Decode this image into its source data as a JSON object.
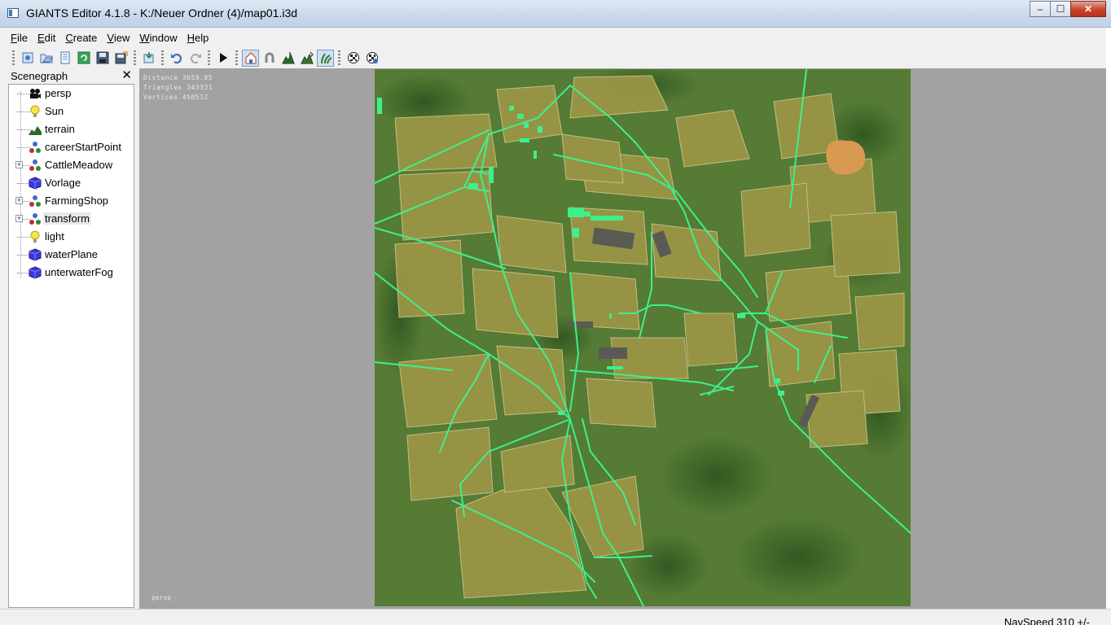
{
  "window": {
    "title": "GIANTS Editor 4.1.8 - K:/Neuer Ordner (4)/map01.i3d",
    "minimize": "–",
    "maximize": "☐",
    "close": "✕"
  },
  "menu": [
    {
      "label": "File",
      "mnemonic": "F",
      "rest": "ile"
    },
    {
      "label": "Edit",
      "mnemonic": "E",
      "rest": "dit"
    },
    {
      "label": "Create",
      "mnemonic": "C",
      "rest": "reate"
    },
    {
      "label": "View",
      "mnemonic": "V",
      "rest": "iew"
    },
    {
      "label": "Window",
      "mnemonic": "W",
      "rest": "indow"
    },
    {
      "label": "Help",
      "mnemonic": "H",
      "rest": "elp"
    }
  ],
  "toolbar": {
    "icons": [
      "new-icon",
      "open-icon",
      "list-icon",
      "reload-icon",
      "save-icon",
      "save-all-icon",
      "import-icon",
      "undo-icon",
      "redo-icon",
      "play-icon",
      "home-icon",
      "magnet-icon",
      "terrain-sculpt-icon",
      "terrain-paint-icon",
      "foliage-paint-icon",
      "checker-icon",
      "checker-settings-icon"
    ]
  },
  "scenegraph": {
    "title": "Scenegraph",
    "close": "✕",
    "items": [
      {
        "label": "persp",
        "icon": "camera-icon",
        "expandable": false
      },
      {
        "label": "Sun",
        "icon": "light-bulb-icon",
        "expandable": false
      },
      {
        "label": "terrain",
        "icon": "terrain-icon",
        "expandable": false
      },
      {
        "label": "careerStartPoint",
        "icon": "transform-group-icon",
        "expandable": false
      },
      {
        "label": "CattleMeadow",
        "icon": "transform-group-icon",
        "expandable": true
      },
      {
        "label": "Vorlage",
        "icon": "shape-cube-icon",
        "expandable": false
      },
      {
        "label": "FarmingShop",
        "icon": "transform-group-icon",
        "expandable": true
      },
      {
        "label": "transform",
        "icon": "transform-group-icon",
        "expandable": true,
        "selected": true
      },
      {
        "label": "light",
        "icon": "light-bulb-icon",
        "expandable": false
      },
      {
        "label": "waterPlane",
        "icon": "shape-cube-icon",
        "expandable": false
      },
      {
        "label": "unterwaterFog",
        "icon": "shape-cube-icon",
        "expandable": false
      }
    ]
  },
  "viewport": {
    "stats": {
      "distance": "Distance 3659.05",
      "triangles": "Triangles 343331",
      "vertices": "Vertices 450512"
    },
    "camera": "persp"
  },
  "statusbar": {
    "navspeed": "NavSpeed 310 +/-"
  },
  "colors": {
    "road_overlay": "#3df08c",
    "terrain_green": "#4d7530",
    "field_yellow": "#9c9848",
    "viewport_bg": "#a2a2a2"
  }
}
